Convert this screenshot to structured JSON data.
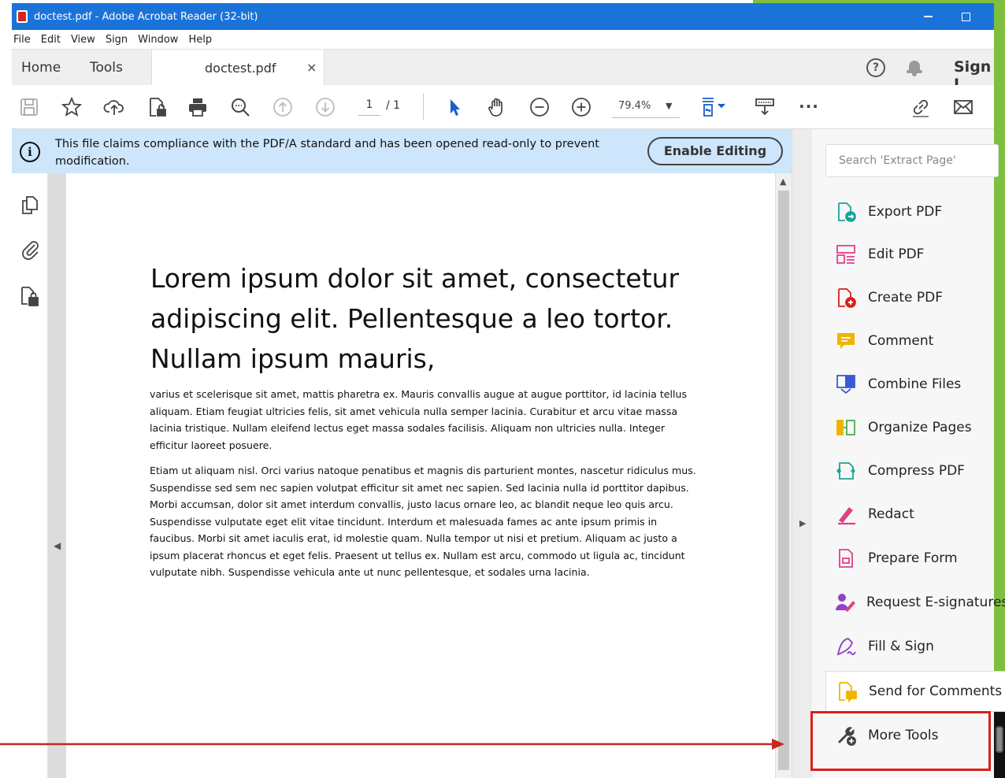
{
  "window": {
    "title": "doctest.pdf - Adobe Acrobat Reader (32-bit)"
  },
  "menu": [
    "File",
    "Edit",
    "View",
    "Sign",
    "Window",
    "Help"
  ],
  "tabs": {
    "home": "Home",
    "tools": "Tools",
    "document": "doctest.pdf",
    "close": "×",
    "help": "?",
    "sign": "Sign I"
  },
  "toolbar": {
    "page_current": "1",
    "page_total": "/ 1",
    "zoom": "79.4%",
    "zoom_caret": "▼",
    "more": "..."
  },
  "banner": {
    "message": "This file claims compliance with the PDF/A standard and has been opened read-only to prevent modification.",
    "enable_button": "Enable Editing"
  },
  "document": {
    "heading": "Lorem ipsum dolor sit amet, consectetur adipiscing elit. Pellentesque a leo tortor. Nullam ipsum mauris,",
    "paragraphs": [
      "varius et scelerisque sit amet, mattis pharetra ex. Mauris convallis augue at augue porttitor, id lacinia tellus aliquam. Etiam feugiat ultricies felis, sit amet vehicula nulla semper lacinia. Curabitur et arcu vitae massa lacinia tristique. Nullam eleifend lectus eget massa sodales facilisis. Aliquam non ultricies nulla. Integer efficitur laoreet posuere.",
      "Etiam ut aliquam nisl. Orci varius natoque penatibus et magnis dis parturient montes, nascetur ridiculus mus. Suspendisse sed sem nec sapien volutpat efficitur sit amet nec sapien. Sed lacinia nulla id porttitor dapibus. Morbi accumsan, dolor sit amet interdum convallis, justo lacus ornare leo, ac blandit neque leo quis arcu. Suspendisse vulputate eget elit vitae tincidunt. Interdum et malesuada fames ac ante ipsum primis in faucibus. Morbi sit amet iaculis erat, id molestie quam. Nulla tempor ut nisi et pretium. Aliquam ac justo a ipsum placerat rhoncus et eget felis. Praesent ut tellus ex. Nullam est arcu, commodo ut ligula ac, tincidunt vulputate nibh. Suspendisse vehicula ante ut nunc pellentesque, et sodales urna lacinia."
    ]
  },
  "tools_panel": {
    "search_placeholder": "Search 'Extract Page'",
    "items": [
      {
        "label": "Export PDF",
        "icon": "export-pdf-icon",
        "color": "#1aa39a"
      },
      {
        "label": "Edit PDF",
        "icon": "edit-pdf-icon",
        "color": "#e0408a"
      },
      {
        "label": "Create PDF",
        "icon": "create-pdf-icon",
        "color": "#d9201c"
      },
      {
        "label": "Comment",
        "icon": "comment-icon",
        "color": "#f0b400"
      },
      {
        "label": "Combine Files",
        "icon": "combine-files-icon",
        "color": "#3b5bd6"
      },
      {
        "label": "Organize Pages",
        "icon": "organize-pages-icon",
        "color": "#4caf50"
      },
      {
        "label": "Compress PDF",
        "icon": "compress-pdf-icon",
        "color": "#1aa39a"
      },
      {
        "label": "Redact",
        "icon": "redact-icon",
        "color": "#e0408a"
      },
      {
        "label": "Prepare Form",
        "icon": "prepare-form-icon",
        "color": "#e0408a"
      },
      {
        "label": "Request E-signatures",
        "icon": "request-esignature-icon",
        "color": "#8e44c9"
      },
      {
        "label": "Fill & Sign",
        "icon": "fill-sign-icon",
        "color": "#8e44c9"
      },
      {
        "label": "Send for Comments",
        "icon": "send-for-comments-icon",
        "color": "#f0b400"
      },
      {
        "label": "More Tools",
        "icon": "more-tools-icon",
        "color": "#444444"
      }
    ]
  },
  "colors": {
    "titlebar": "#1a73d9",
    "banner": "#cde6fb",
    "highlight": "#d9201c"
  }
}
